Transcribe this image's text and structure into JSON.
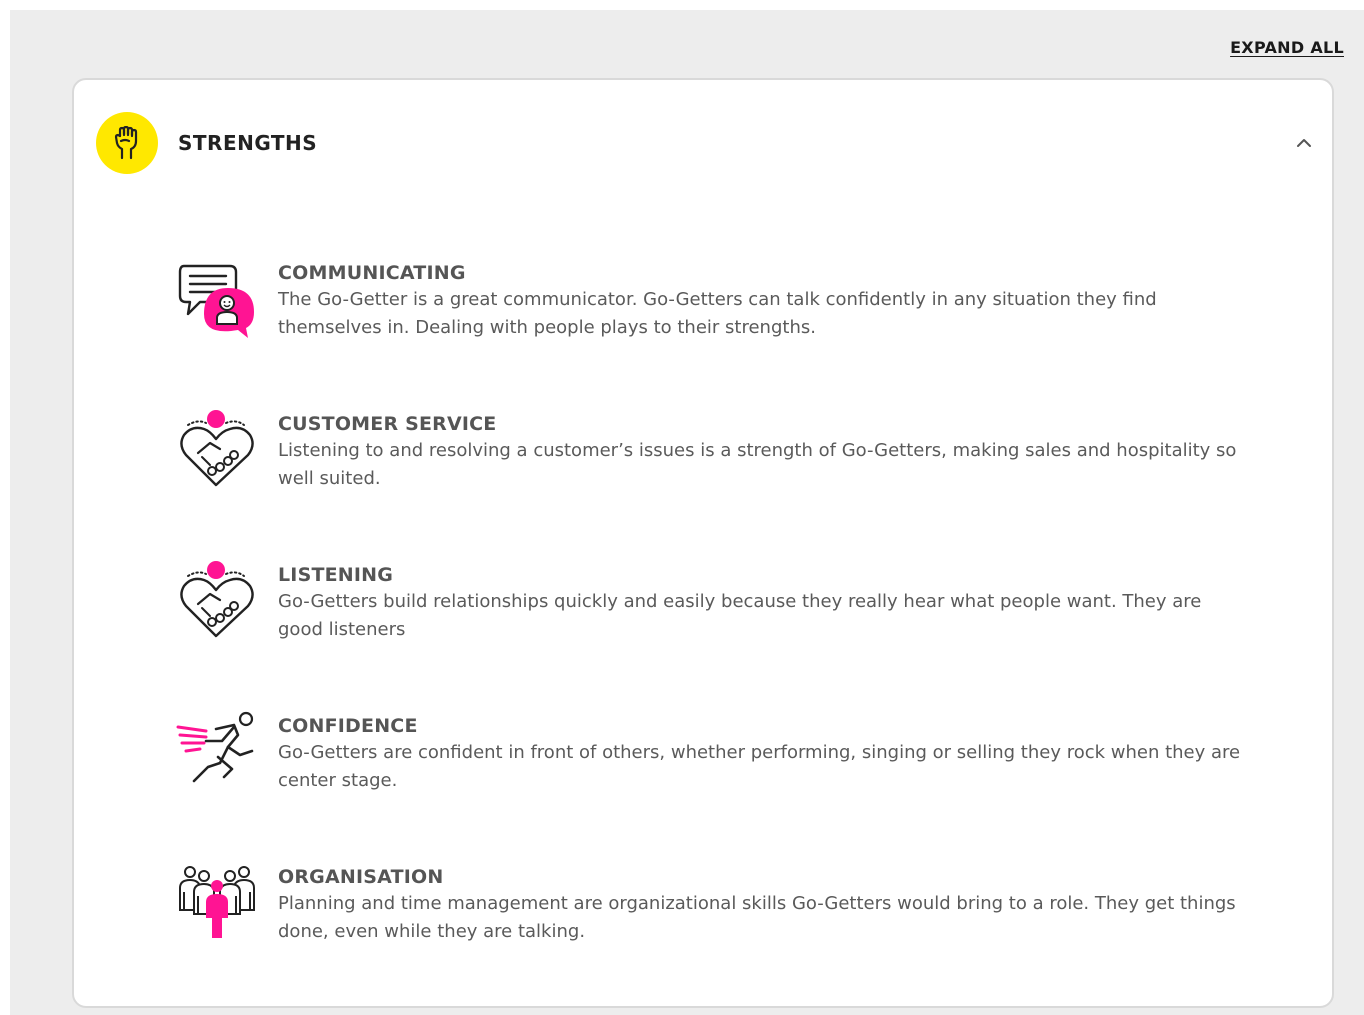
{
  "toolbar": {
    "expand_all_label": "EXPAND ALL"
  },
  "section": {
    "title": "STRENGTHS",
    "icon": "raised-fist-icon",
    "expanded": true
  },
  "colors": {
    "accent_yellow": "#ffe800",
    "accent_pink": "#ff1493",
    "text_dark": "#222222",
    "text_body": "#5a5a5a"
  },
  "items": [
    {
      "title": "COMMUNICATING",
      "description": "The Go-Getter is a great communicator. Go-Getters can talk confidently in any situation they find themselves in. Dealing with people plays to their strengths.",
      "icon": "speech-bubbles-icon"
    },
    {
      "title": "CUSTOMER SERVICE",
      "description": "Listening to and resolving a customer’s issues is a strength of Go-Getters, making sales and hospitality so well suited.",
      "icon": "heart-handshake-icon"
    },
    {
      "title": "LISTENING",
      "description": "Go-Getters build relationships quickly and easily because they really hear what people want. They are good listeners",
      "icon": "heart-handshake-icon"
    },
    {
      "title": "CONFIDENCE",
      "description": "Go-Getters are confident in front of others, whether performing, singing or selling they rock when they are center stage.",
      "icon": "running-person-icon"
    },
    {
      "title": "ORGANISATION",
      "description": "Planning and time management are organizational skills Go-Getters would bring to a role. They get things done, even while they are talking.",
      "icon": "team-people-icon"
    }
  ]
}
